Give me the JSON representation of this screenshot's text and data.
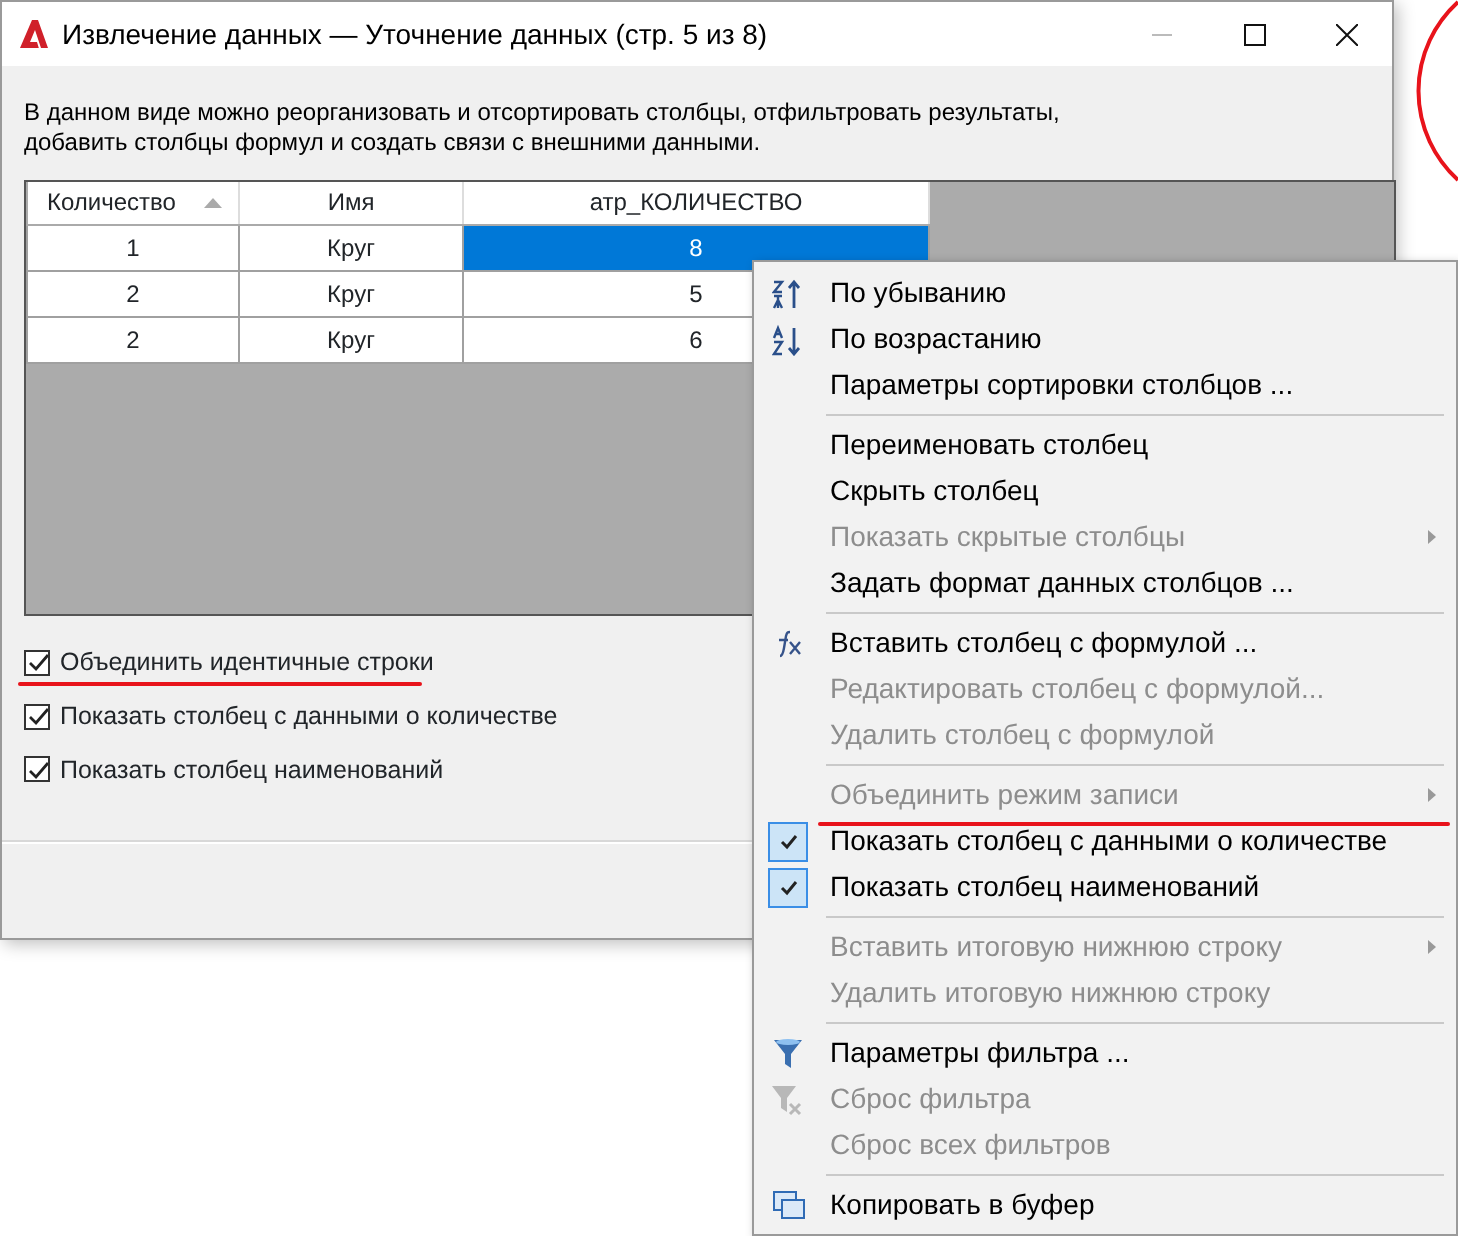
{
  "window": {
    "title": "Извлечение данных — Уточнение данных (стр. 5 из 8)"
  },
  "description": "В данном виде можно реорганизовать и отсортировать столбцы, отфильтровать результаты, добавить столбцы формул и создать связи с внешними данными.",
  "table": {
    "columns": [
      {
        "label": "Количество",
        "sorted": true
      },
      {
        "label": "Имя",
        "sorted": false
      },
      {
        "label": "атр_КОЛИЧЕСТВО",
        "sorted": false
      }
    ],
    "rows": [
      {
        "cells": [
          {
            "text": "1",
            "selected": false
          },
          {
            "text": "Круг",
            "selected": false
          },
          {
            "text": "8",
            "selected": true
          }
        ]
      },
      {
        "cells": [
          {
            "text": "2",
            "selected": false
          },
          {
            "text": "Круг",
            "selected": false
          },
          {
            "text": "5",
            "selected": false
          }
        ]
      },
      {
        "cells": [
          {
            "text": "2",
            "selected": false
          },
          {
            "text": "Круг",
            "selected": false
          },
          {
            "text": "6",
            "selected": false
          }
        ]
      }
    ]
  },
  "options": [
    {
      "label": "Объединить идентичные строки",
      "checked": true,
      "annotated": true
    },
    {
      "label": "Показать столбец с данными о количестве",
      "checked": true
    },
    {
      "label": "Показать столбец наименований",
      "checked": true
    }
  ],
  "context_menu": [
    {
      "kind": "sort-desc",
      "label": "По убыванию",
      "disabled": false
    },
    {
      "kind": "sort-asc",
      "label": "По возрастанию",
      "disabled": false
    },
    {
      "kind": "plain",
      "label": "Параметры сортировки столбцов ...",
      "disabled": false
    },
    {
      "kind": "separator"
    },
    {
      "kind": "plain",
      "label": "Переименовать столбец",
      "disabled": false
    },
    {
      "kind": "plain",
      "label": "Скрыть столбец",
      "disabled": false
    },
    {
      "kind": "plain",
      "label": "Показать скрытые столбцы",
      "disabled": true,
      "submenu": true
    },
    {
      "kind": "plain",
      "label": "Задать формат данных столбцов ...",
      "disabled": false
    },
    {
      "kind": "separator"
    },
    {
      "kind": "formula",
      "label": "Вставить столбец с формулой ...",
      "disabled": false
    },
    {
      "kind": "plain",
      "label": "Редактировать столбец с формулой...",
      "disabled": true
    },
    {
      "kind": "plain",
      "label": "Удалить столбец с формулой",
      "disabled": true
    },
    {
      "kind": "separator"
    },
    {
      "kind": "plain",
      "label": "Объединить режим записи",
      "disabled": true,
      "submenu": true,
      "annotated": true
    },
    {
      "kind": "check",
      "label": "Показать столбец с данными о количестве",
      "disabled": false,
      "checked": true
    },
    {
      "kind": "check",
      "label": "Показать столбец наименований",
      "disabled": false,
      "checked": true
    },
    {
      "kind": "separator"
    },
    {
      "kind": "plain",
      "label": "Вставить итоговую нижнюю строку",
      "disabled": true,
      "submenu": true
    },
    {
      "kind": "plain",
      "label": "Удалить итоговую нижнюю строку",
      "disabled": true
    },
    {
      "kind": "separator"
    },
    {
      "kind": "filter",
      "label": "Параметры фильтра ...",
      "disabled": false
    },
    {
      "kind": "filter-clear",
      "label": "Сброс фильтра",
      "disabled": true
    },
    {
      "kind": "plain",
      "label": "Сброс всех фильтров",
      "disabled": true
    },
    {
      "kind": "separator"
    },
    {
      "kind": "copy",
      "label": "Копировать в буфер",
      "disabled": false
    }
  ]
}
